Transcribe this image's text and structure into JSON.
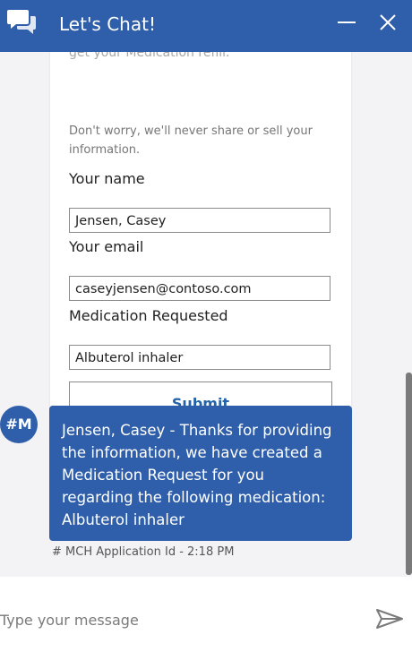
{
  "header": {
    "title": "Let's Chat!",
    "minimize_label": "—",
    "close_label": "✕"
  },
  "form_card": {
    "cut_off_line": "get your Medication refill.",
    "disclaimer": "Don't worry, we'll never share or sell your information.",
    "name_label": "Your name",
    "name_value": "Jensen, Casey",
    "email_label": "Your email",
    "email_value": "caseyjensen@contoso.com",
    "medication_label": "Medication Requested",
    "medication_value": "Albuterol inhaler",
    "submit_label": "Submit"
  },
  "bot_message": {
    "avatar_initials": "#M",
    "lines": [
      "Jensen, Casey - Thanks for providing",
      "the information, we have created a",
      "Medication Request for you",
      "regarding the following medication:",
      "Albuterol inhaler"
    ],
    "meta": "# MCH Application Id - 2:18 PM"
  },
  "composer": {
    "placeholder": "Type your message",
    "value": ""
  },
  "colors": {
    "brand": "#2f5faa",
    "submit_text": "#2563a8",
    "background": "#f3f3f5"
  },
  "icons": {
    "header_icon": "chat-bubbles-icon",
    "minimize": "minimize-icon",
    "close": "close-icon",
    "send": "send-icon"
  }
}
